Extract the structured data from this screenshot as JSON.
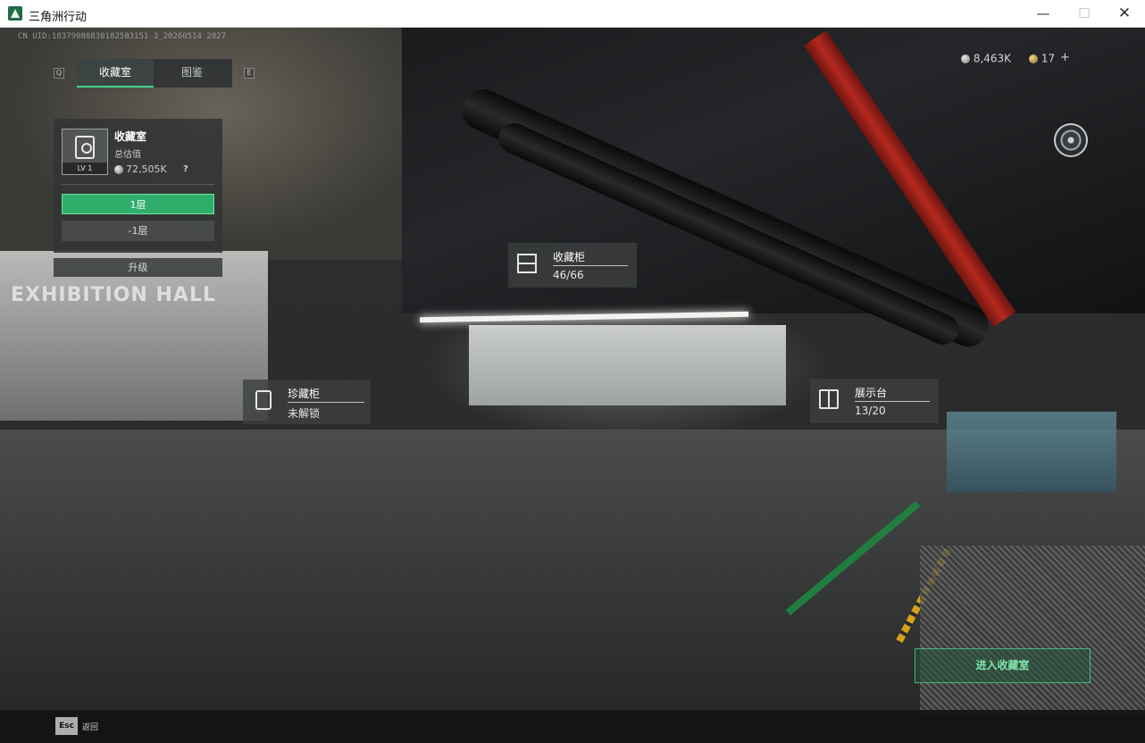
{
  "window": {
    "title": "三角洲行动",
    "minimize_glyph": "—",
    "maximize_glyph": "☐",
    "close_glyph": "✕"
  },
  "hud": {
    "uid_text": "CN UID:18379080830182583151 3_20260514 2027",
    "hall_sign": "EXHIBITION HALL"
  },
  "tabs": {
    "left_key": "Q",
    "right_key": "E",
    "items": [
      {
        "label": "收藏室",
        "active": true
      },
      {
        "label": "图鉴",
        "active": false
      }
    ]
  },
  "room_panel": {
    "title": "收藏室",
    "subtitle": "总估值",
    "value": "72,505K",
    "help": "?",
    "level": "LV 1",
    "floors": [
      {
        "label": "1层",
        "active": true
      },
      {
        "label": "-1层",
        "active": false
      }
    ],
    "upgrade_label": "升级"
  },
  "currency": {
    "silver": "8,463K",
    "gold": "17",
    "plus": "+"
  },
  "markers": {
    "cabinet": {
      "name": "收藏柜",
      "value": "46/66"
    },
    "vault": {
      "name": "珍藏柜",
      "value": "未解锁"
    },
    "display": {
      "name": "展示台",
      "value": "13/20"
    }
  },
  "enter_button": "进入收藏室",
  "footer": {
    "esc_key": "Esc",
    "esc_label": "返回"
  },
  "colors": {
    "accent_green": "#2fae6b",
    "enter_text": "#7fe6ac"
  }
}
